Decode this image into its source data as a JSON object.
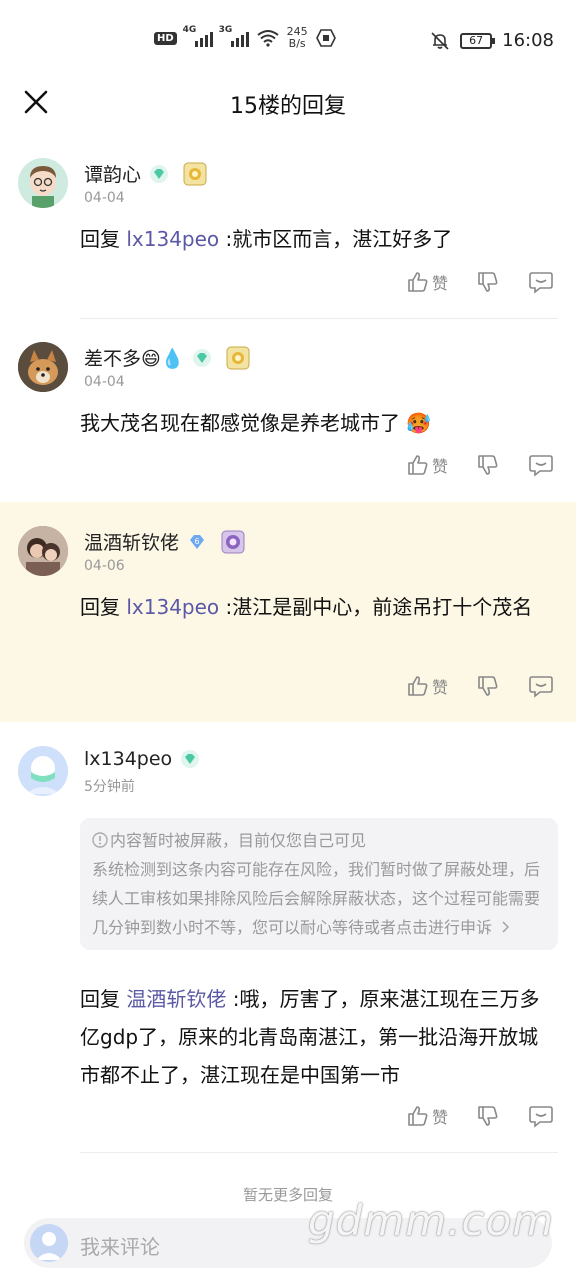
{
  "status_bar": {
    "hd": "HD",
    "net1": "4G",
    "net2": "3G",
    "speed_value": "245",
    "speed_unit": "B/s",
    "battery": "67",
    "time": "16:08"
  },
  "header": {
    "title": "15楼的回复"
  },
  "comments": [
    {
      "username": "谭韵心",
      "date": "04-04",
      "reply_prefix": "回复 ",
      "mention": "lx134peo",
      "text": " :就市区而言，湛江好多了",
      "like_label": "赞"
    },
    {
      "username": "差不多😄💧",
      "date": "04-04",
      "text": "我大茂名现在都感觉像是养老城市了 🥵",
      "like_label": "赞"
    },
    {
      "username": "温酒斩钦佬",
      "date": "04-06",
      "gem_level": "6",
      "reply_prefix": "回复 ",
      "mention": "lx134peo",
      "text": " :湛江是副中心，前途吊打十个茂名",
      "like_label": "赞"
    },
    {
      "username": "lx134peo",
      "date": "5分钟前",
      "notice_title": "内容暂时被屏蔽，目前仅您自己可见",
      "notice_body": "系统检测到这条内容可能存在风险，我们暂时做了屏蔽处理，后续人工审核如果排除风险后会解除屏蔽状态，这个过程可能需要几分钟到数小时不等，您可以耐心等待或者点击进行申诉",
      "reply_prefix": "回复 ",
      "mention": "温酒斩钦佬",
      "text": " :哦，厉害了，原来湛江现在三万多亿gdp了，原来的北青岛南湛江，第一批沿海开放城市都不止了，湛江现在是中国第一市",
      "like_label": "赞"
    }
  ],
  "footer": {
    "no_more": "暂无更多回复",
    "input_placeholder": "我来评论",
    "watermark": "gdmm.com"
  },
  "colors": {
    "mention": "#5b59a6",
    "highlight_bg": "#fdf8e6",
    "gem": "#4cc9a4"
  }
}
